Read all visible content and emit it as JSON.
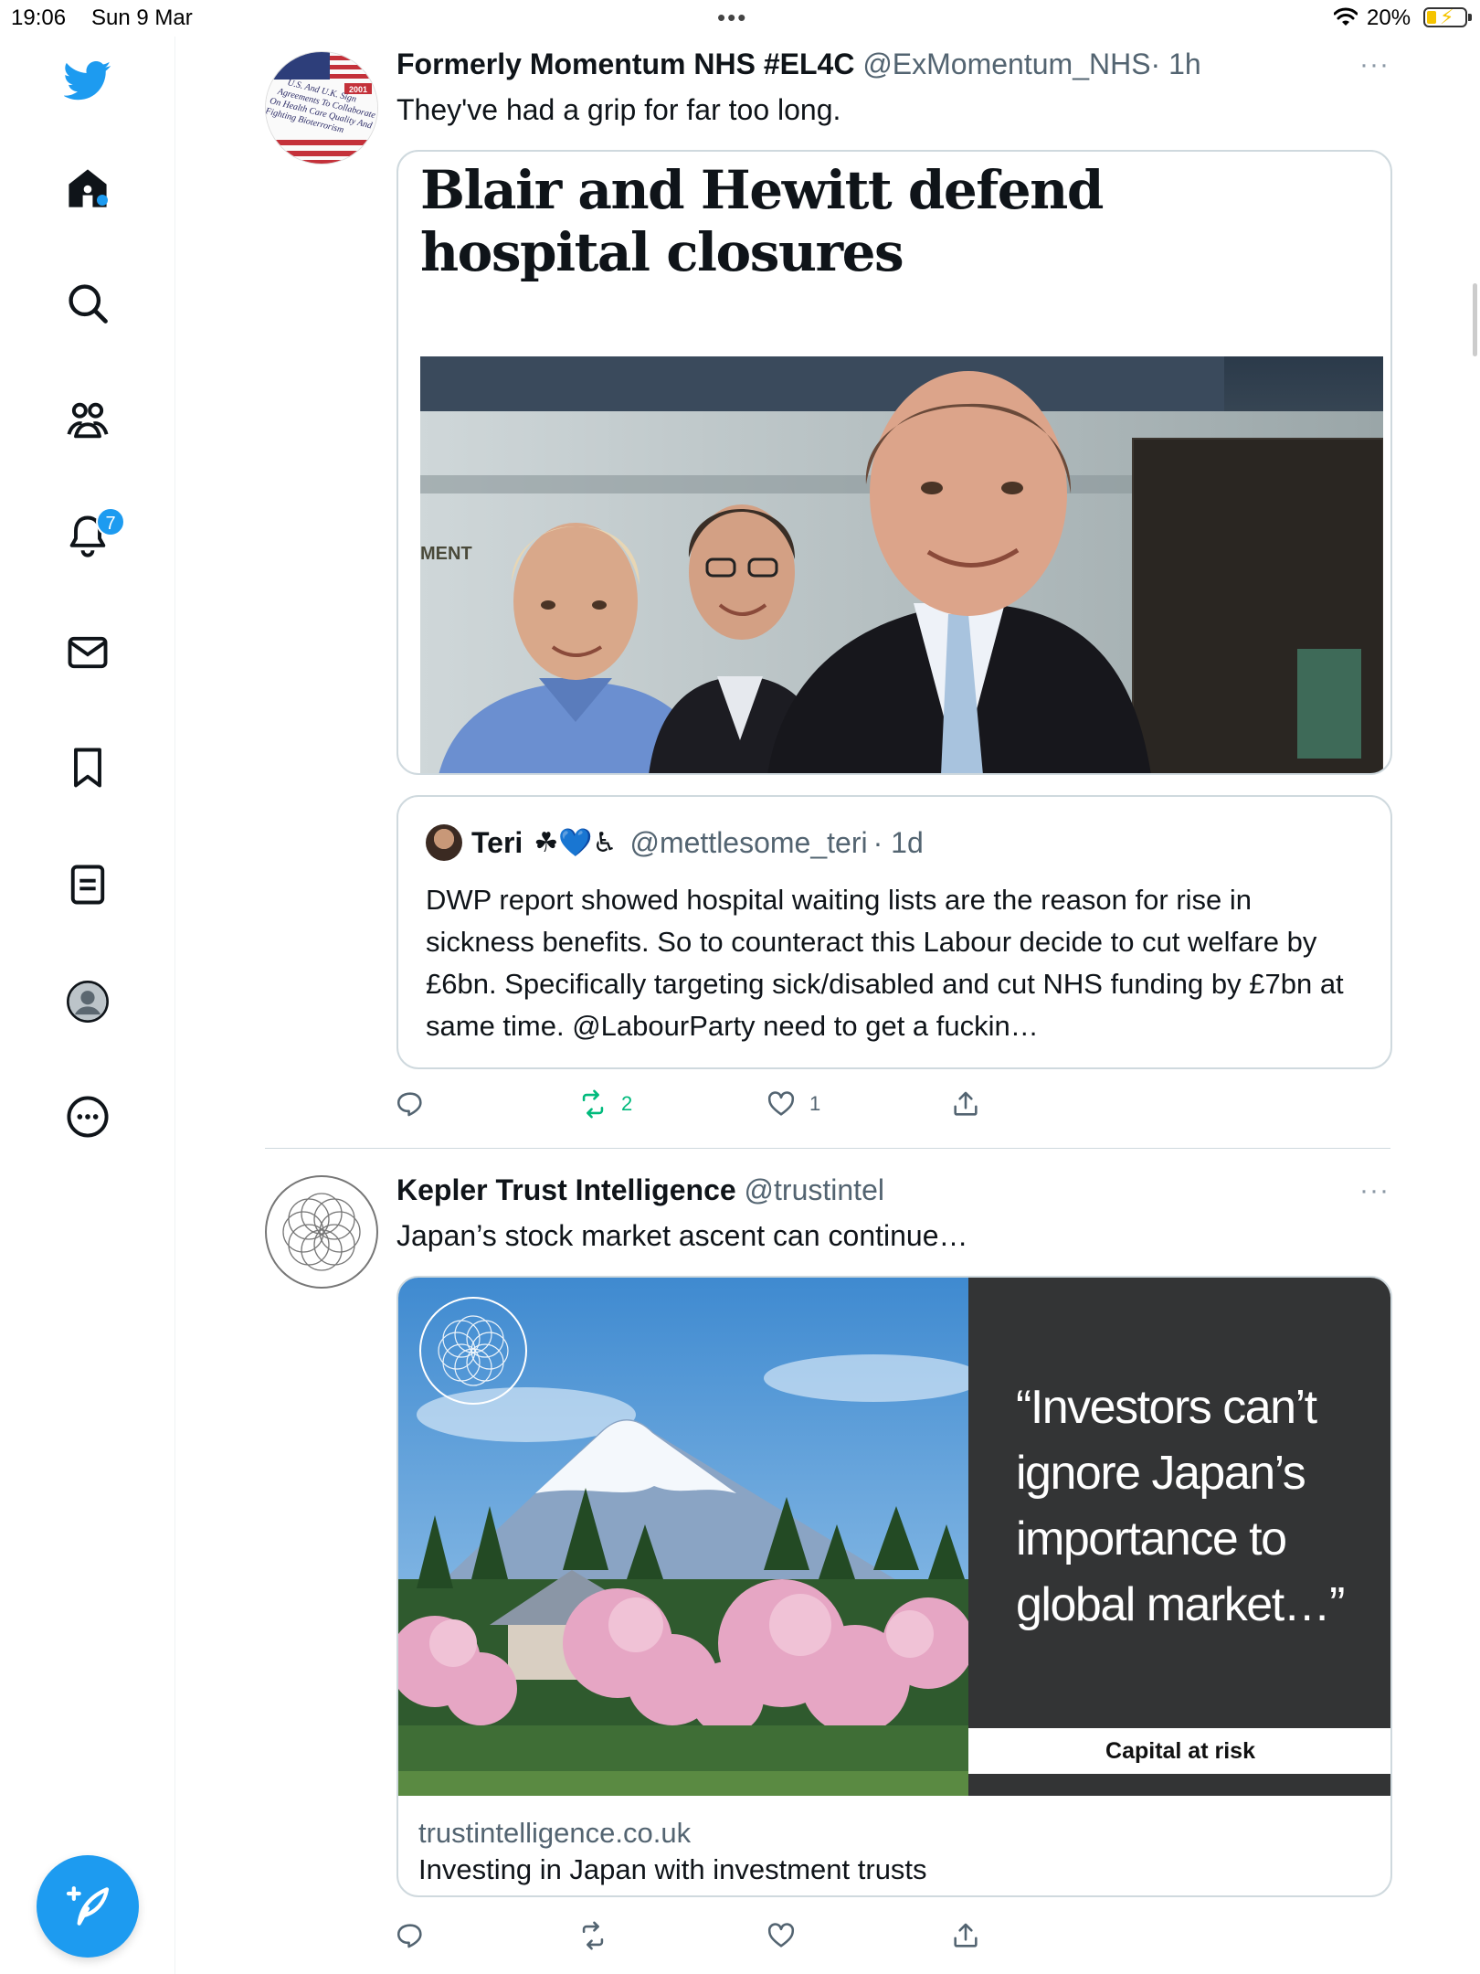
{
  "status_bar": {
    "time": "19:06",
    "date": "Sun 9 Mar",
    "battery": "20%"
  },
  "sidebar": {
    "items": [
      {
        "name": "twitter-logo",
        "icon": "bird-icon"
      },
      {
        "name": "home",
        "icon": "home-icon"
      },
      {
        "name": "explore",
        "icon": "search-icon"
      },
      {
        "name": "communities",
        "icon": "people-icon"
      },
      {
        "name": "notifications",
        "icon": "bell-icon",
        "badge": "7"
      },
      {
        "name": "messages",
        "icon": "envelope-icon"
      },
      {
        "name": "bookmarks",
        "icon": "bookmark-icon"
      },
      {
        "name": "lists",
        "icon": "list-icon"
      },
      {
        "name": "profile",
        "icon": "avatar-icon"
      },
      {
        "name": "more",
        "icon": "more-circle-icon"
      }
    ],
    "notifications_badge": "7",
    "compose_icon": "compose-icon"
  },
  "tweets": [
    {
      "name": "Formerly Momentum NHS #EL4C",
      "handle": "@ExMomentum_NHS",
      "time": "· 1h",
      "text": "They've had a grip for far too long.",
      "avatar_text": [
        "U.S. And U.K. Sign",
        "Agreements To Collaborate",
        "On Health Care Quality And",
        "Fighting Bioterrorism"
      ],
      "avatar_year": "2001",
      "article_headline": "Blair and Hewitt defend hospital closures",
      "photo_sign": "MENT",
      "quote": {
        "name": "Teri",
        "emojis": "☘💙♿",
        "handle": "@mettlesome_teri",
        "time": "· 1d",
        "text": "DWP report showed hospital waiting lists are the reason for rise in sickness benefits. So to counteract this Labour decide to cut welfare by £6bn. Specifically targeting sick/disabled and cut NHS funding by £7bn at same time. @LabourParty need to get a fuckin…"
      },
      "actions": {
        "replies": "",
        "retweets": "2",
        "likes": "1"
      }
    },
    {
      "name": "Kepler Trust Intelligence",
      "handle": "@trustintel",
      "time": "",
      "text": "Japan’s stock market ascent can continue…",
      "promo_quote": "“Investors can’t ignore Japan’s importance to global market…”",
      "capital_note": "Capital at risk",
      "card_domain": "trustintelligence.co.uk",
      "card_title": "Investing in Japan with investment trusts"
    }
  ],
  "colors": {
    "accent": "#1d9bf0",
    "retweet_green": "#00ba7c",
    "secondary_text": "#536471",
    "border": "#cfd9de"
  }
}
